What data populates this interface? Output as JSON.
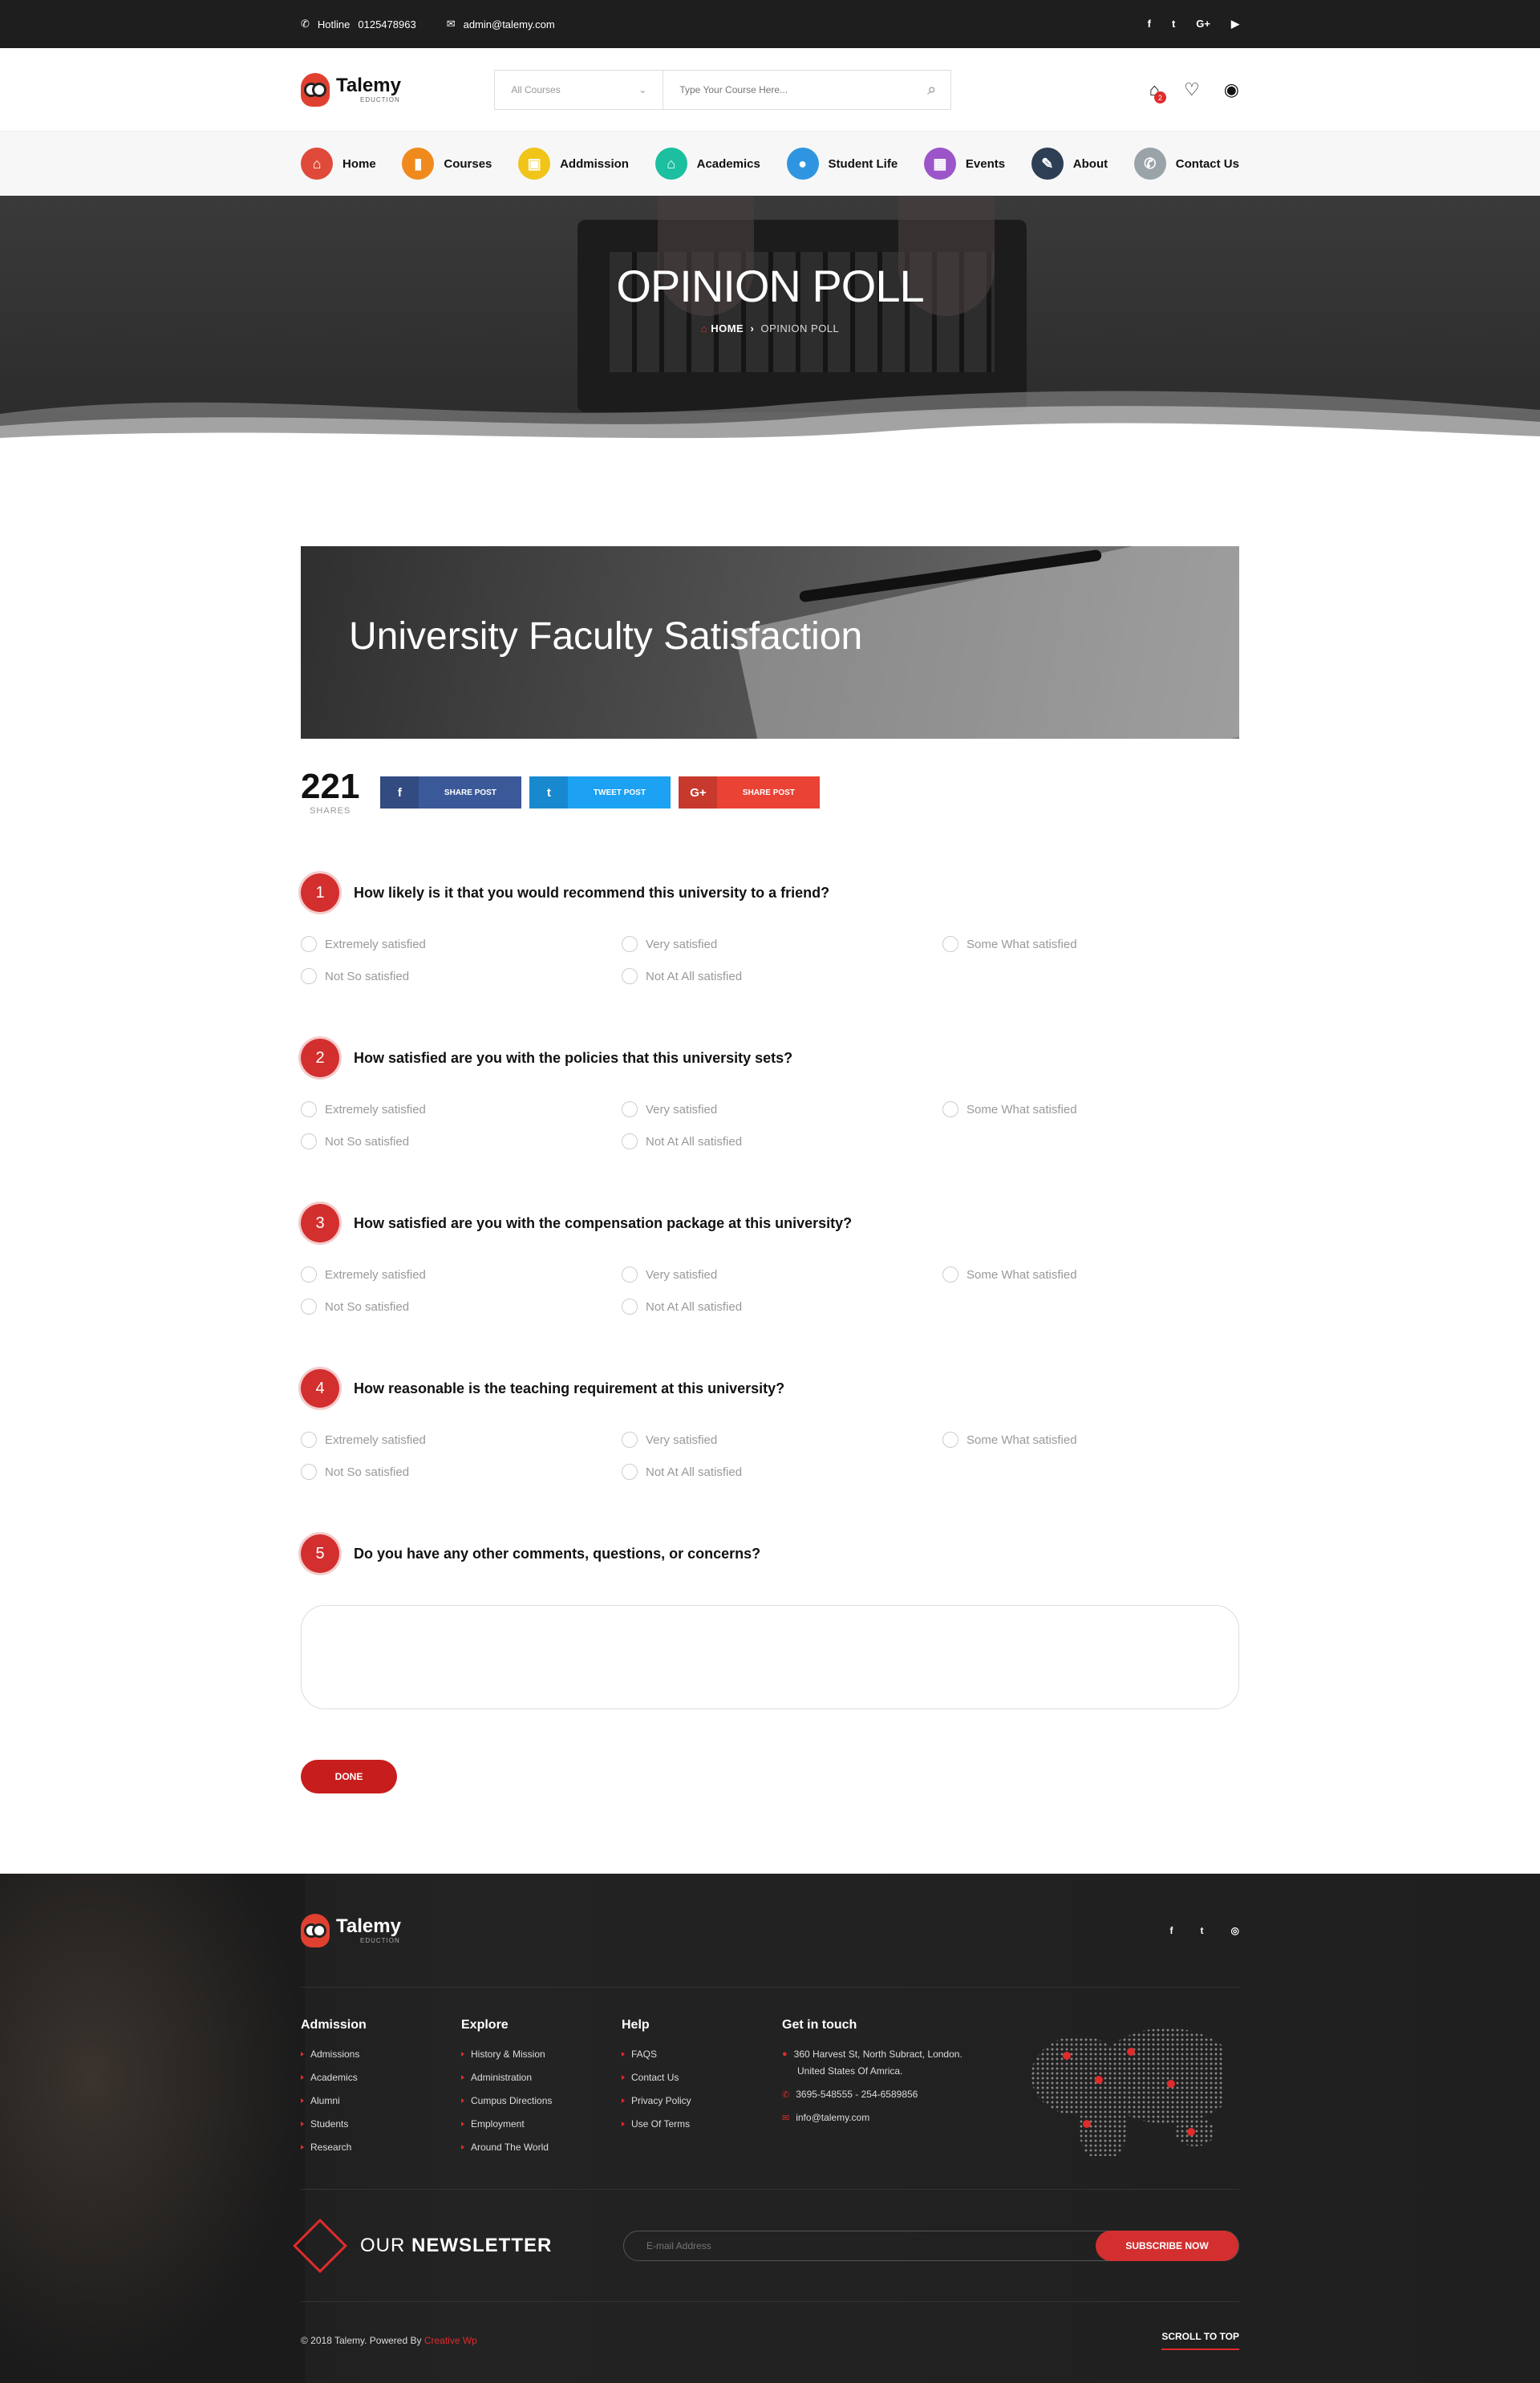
{
  "topbar": {
    "hotline_label": "Hotline",
    "hotline": "0125478963",
    "email": "admin@talemy.com",
    "social": [
      "f",
      "t",
      "G+",
      "▶"
    ]
  },
  "logo": {
    "name": "Talemy",
    "sub": "EDUCTION"
  },
  "search": {
    "category": "All Courses",
    "placeholder": "Type Your Course Here..."
  },
  "header": {
    "cart_count": "2"
  },
  "nav": [
    {
      "label": "Home",
      "color": "#e04a3a",
      "icon": "home-icon",
      "glyph": "⌂"
    },
    {
      "label": "Courses",
      "color": "#f08a1c",
      "icon": "book-icon",
      "glyph": "▮"
    },
    {
      "label": "Addmission",
      "color": "#f0c419",
      "icon": "clipboard-icon",
      "glyph": "▣"
    },
    {
      "label": "Academics",
      "color": "#1cbfa0",
      "icon": "bank-icon",
      "glyph": "⌂"
    },
    {
      "label": "Student Life",
      "color": "#2f95e0",
      "icon": "user-icon",
      "glyph": "●"
    },
    {
      "label": "Events",
      "color": "#9b55c9",
      "icon": "calendar-icon",
      "glyph": "▦"
    },
    {
      "label": "About",
      "color": "#2d3e55",
      "icon": "pen-icon",
      "glyph": "✎"
    },
    {
      "label": "Contact Us",
      "color": "#9aa3a8",
      "icon": "phone-icon",
      "glyph": "✆"
    }
  ],
  "hero": {
    "title": "OPINION POLL",
    "crumb_home": "HOME",
    "crumb_current": "OPINION POLL"
  },
  "banner": {
    "title": "University Faculty Satisfaction"
  },
  "shares": {
    "count": "221",
    "label": "SHARES",
    "buttons": [
      {
        "label": "SHARE POST",
        "icon": "f",
        "color": "#3b5998"
      },
      {
        "label": "TWEET POST",
        "icon": "t",
        "color": "#1da1f2"
      },
      {
        "label": "SHARE POST",
        "icon": "G+",
        "color": "#ea4335"
      }
    ]
  },
  "questions": [
    {
      "num": "1",
      "text": "How likely is it that you would recommend this university to a friend?"
    },
    {
      "num": "2",
      "text": "How satisfied are you with the policies that this university sets?"
    },
    {
      "num": "3",
      "text": "How satisfied are you with the compensation package at this university?"
    },
    {
      "num": "4",
      "text": "How reasonable is the teaching requirement at this university?"
    }
  ],
  "options": [
    "Extremely satisfied",
    "Very satisfied",
    "Some What satisfied",
    "Not So satisfied",
    "Not At All  satisfied"
  ],
  "q5": {
    "num": "5",
    "text": "Do you have any other comments, questions, or concerns?"
  },
  "done_label": "DONE",
  "footer": {
    "social": [
      "f",
      "t",
      "◎"
    ],
    "cols": [
      {
        "title": "Admission",
        "items": [
          "Admissions",
          "Academics",
          "Alumni",
          "Students",
          "Research"
        ]
      },
      {
        "title": "Explore",
        "items": [
          "History & Mission",
          "Administration",
          "Cumpus Directions",
          "Employment",
          "Around The World"
        ]
      },
      {
        "title": "Help",
        "items": [
          "FAQS",
          "Contact Us",
          "Privacy Policy",
          "Use Of Terms"
        ]
      }
    ],
    "contact": {
      "title": "Get in touch",
      "address1": "360 Harvest St, North Subract, London.",
      "address2": "United States Of Amrica.",
      "phone": "3695-548555   -   254-6589856",
      "email": "info@talemy.com"
    },
    "newsletter": {
      "prefix": "OUR",
      "strong": "NEWSLETTER",
      "placeholder": "E-mail Address",
      "button": "SUBSCRIBE NOW"
    },
    "copyright": "© 2018 Talemy.  Powered By ",
    "powered": "Creative Wp",
    "scroll_top": "SCROLL TO TOP"
  }
}
